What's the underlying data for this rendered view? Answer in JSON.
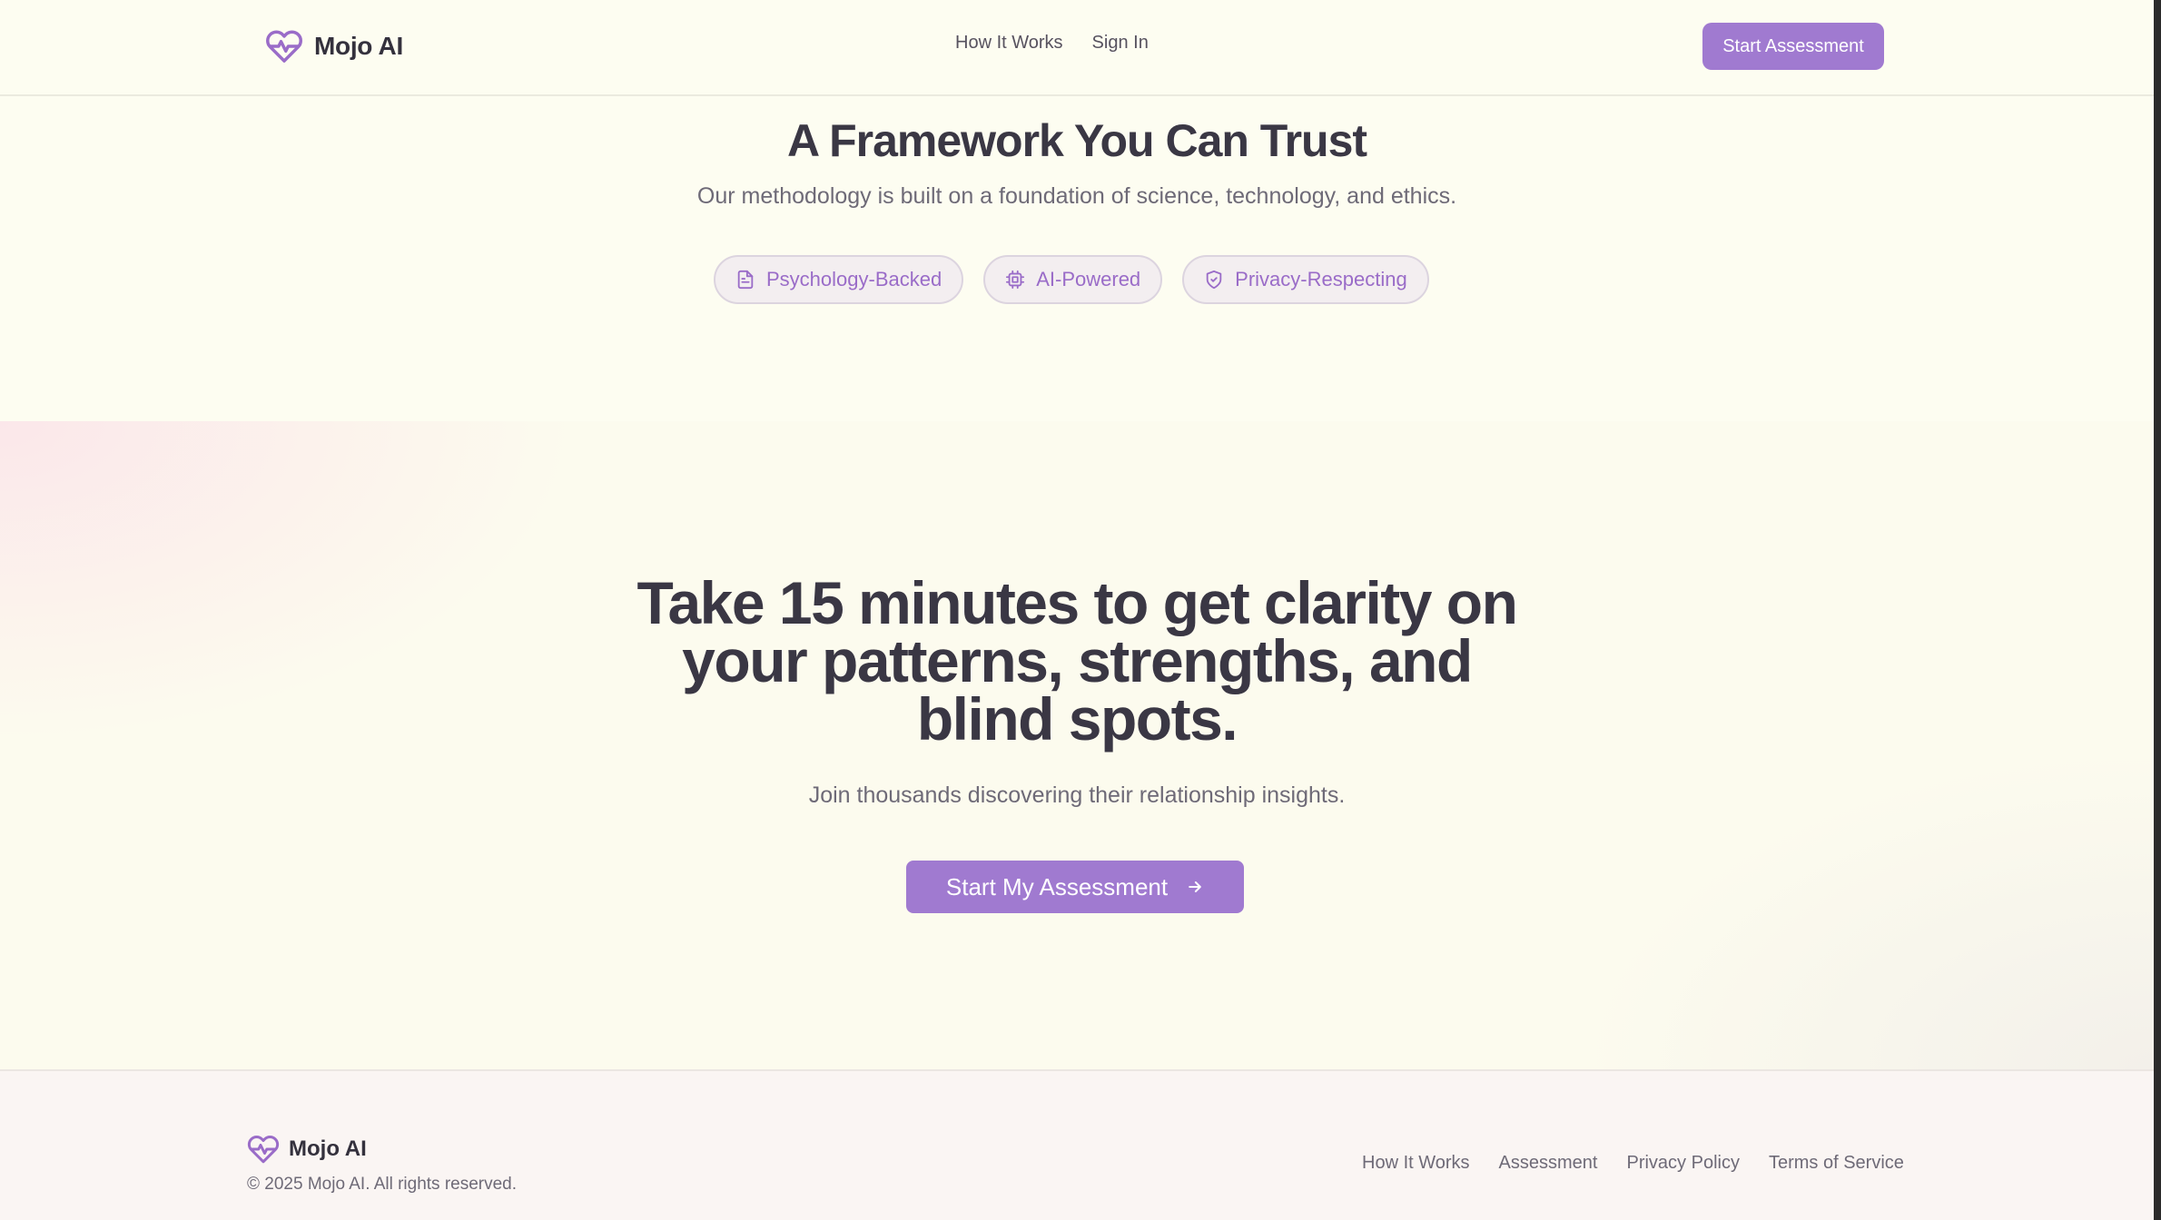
{
  "colors": {
    "accent": "#a07ad0",
    "text_dark": "#3a3744",
    "text_muted": "#6e6a77",
    "background": "#fdfdf1"
  },
  "header": {
    "brand": {
      "name": "Mojo AI",
      "icon": "heart-pulse-icon"
    },
    "nav": [
      {
        "label": "How It Works"
      },
      {
        "label": "Sign In"
      }
    ],
    "cta_label": "Start Assessment"
  },
  "framework": {
    "title": "A Framework You Can Trust",
    "subtitle": "Our methodology is built on a foundation of science, technology, and ethics.",
    "pills": [
      {
        "label": "Psychology-Backed",
        "icon": "document-icon"
      },
      {
        "label": "AI-Powered",
        "icon": "cpu-icon"
      },
      {
        "label": "Privacy-Respecting",
        "icon": "shield-icon"
      }
    ]
  },
  "hero": {
    "title": "Take 15 minutes to get clarity on your patterns, strengths, and blind spots.",
    "subtitle": "Join thousands discovering their relationship insights.",
    "button_label": "Start My Assessment",
    "button_icon": "arrow-right-icon"
  },
  "footer": {
    "brand": {
      "name": "Mojo AI",
      "icon": "heart-pulse-icon"
    },
    "copyright": "© 2025 Mojo AI. All rights reserved.",
    "links": [
      {
        "label": "How It Works"
      },
      {
        "label": "Assessment"
      },
      {
        "label": "Privacy Policy"
      },
      {
        "label": "Terms of Service"
      }
    ]
  }
}
